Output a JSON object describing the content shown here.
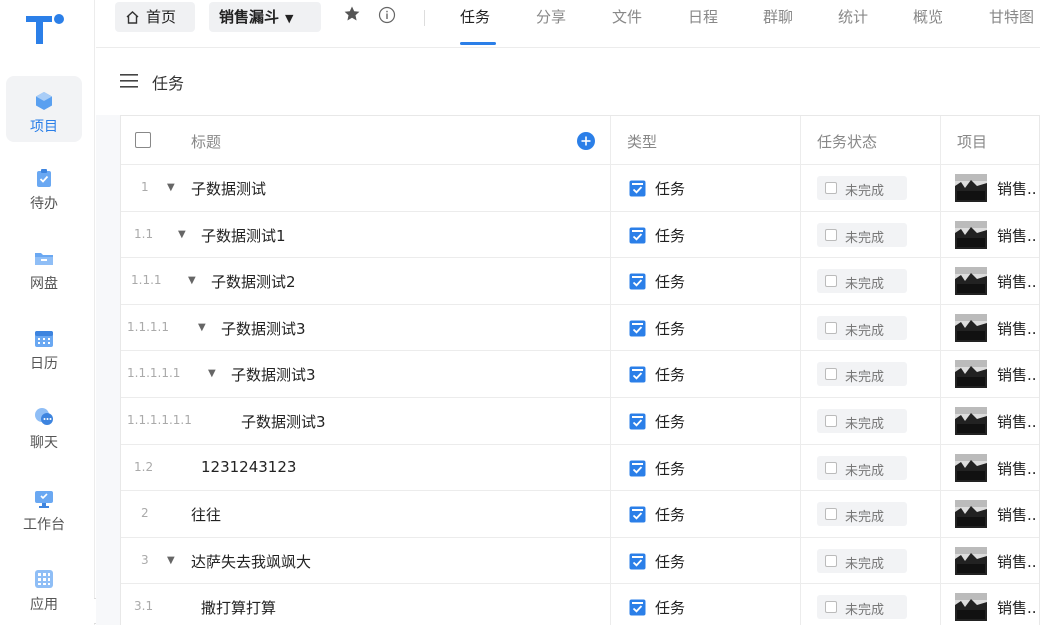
{
  "sidebar": {
    "items": [
      {
        "label": "项目",
        "icon": "project-icon",
        "active": true
      },
      {
        "label": "待办",
        "icon": "todo-icon"
      },
      {
        "label": "网盘",
        "icon": "folder-icon"
      },
      {
        "label": "日历",
        "icon": "calendar-icon"
      },
      {
        "label": "聊天",
        "icon": "chat-icon"
      },
      {
        "label": "工作台",
        "icon": "desktop-icon"
      },
      {
        "label": "应用",
        "icon": "apps-icon"
      }
    ],
    "collapse_glyph": "›"
  },
  "topbar": {
    "home_label": "首页",
    "project_label": "销售漏斗",
    "project_chevron": "▼",
    "tabs": [
      {
        "label": "任务",
        "active": true
      },
      {
        "label": "分享"
      },
      {
        "label": "文件"
      },
      {
        "label": "日程"
      },
      {
        "label": "群聊"
      },
      {
        "label": "统计"
      },
      {
        "label": "概览"
      },
      {
        "label": "甘特图"
      }
    ]
  },
  "view": {
    "title": "任务"
  },
  "table": {
    "columns": {
      "title": "标题",
      "type": "类型",
      "status": "任务状态",
      "project": "项目"
    },
    "rows": [
      {
        "index": "1",
        "name": "子数据测试",
        "level": 0,
        "expandable": true,
        "type": "任务",
        "status": "未完成",
        "project": "销售.."
      },
      {
        "index": "1.1",
        "name": "子数据测试1",
        "level": 1,
        "expandable": true,
        "type": "任务",
        "status": "未完成",
        "project": "销售.."
      },
      {
        "index": "1.1.1",
        "name": "子数据测试2",
        "level": 2,
        "expandable": true,
        "type": "任务",
        "status": "未完成",
        "project": "销售.."
      },
      {
        "index": "1.1.1.1",
        "name": "子数据测试3",
        "level": 3,
        "expandable": true,
        "type": "任务",
        "status": "未完成",
        "project": "销售.."
      },
      {
        "index": "1.1.1.1.1",
        "name": "子数据测试3",
        "level": 4,
        "expandable": true,
        "type": "任务",
        "status": "未完成",
        "project": "销售.."
      },
      {
        "index": "1.1.1.1.1.1",
        "name": "子数据测试3",
        "level": 5,
        "expandable": false,
        "type": "任务",
        "status": "未完成",
        "project": "销售.."
      },
      {
        "index": "1.2",
        "name": "1231243123",
        "level": 1,
        "expandable": false,
        "type": "任务",
        "status": "未完成",
        "project": "销售.."
      },
      {
        "index": "2",
        "name": "往往",
        "level": 0,
        "expandable": false,
        "type": "任务",
        "status": "未完成",
        "project": "销售.."
      },
      {
        "index": "3",
        "name": "达萨失去我飒飒大",
        "level": 0,
        "expandable": true,
        "type": "任务",
        "status": "未完成",
        "project": "销售.."
      },
      {
        "index": "3.1",
        "name": "撒打算打算",
        "level": 1,
        "expandable": false,
        "type": "任务",
        "status": "未完成",
        "project": "销售.."
      }
    ]
  },
  "colors": {
    "accent": "#2b7fe8",
    "sidebar_active_bg": "#f2f3f5"
  }
}
